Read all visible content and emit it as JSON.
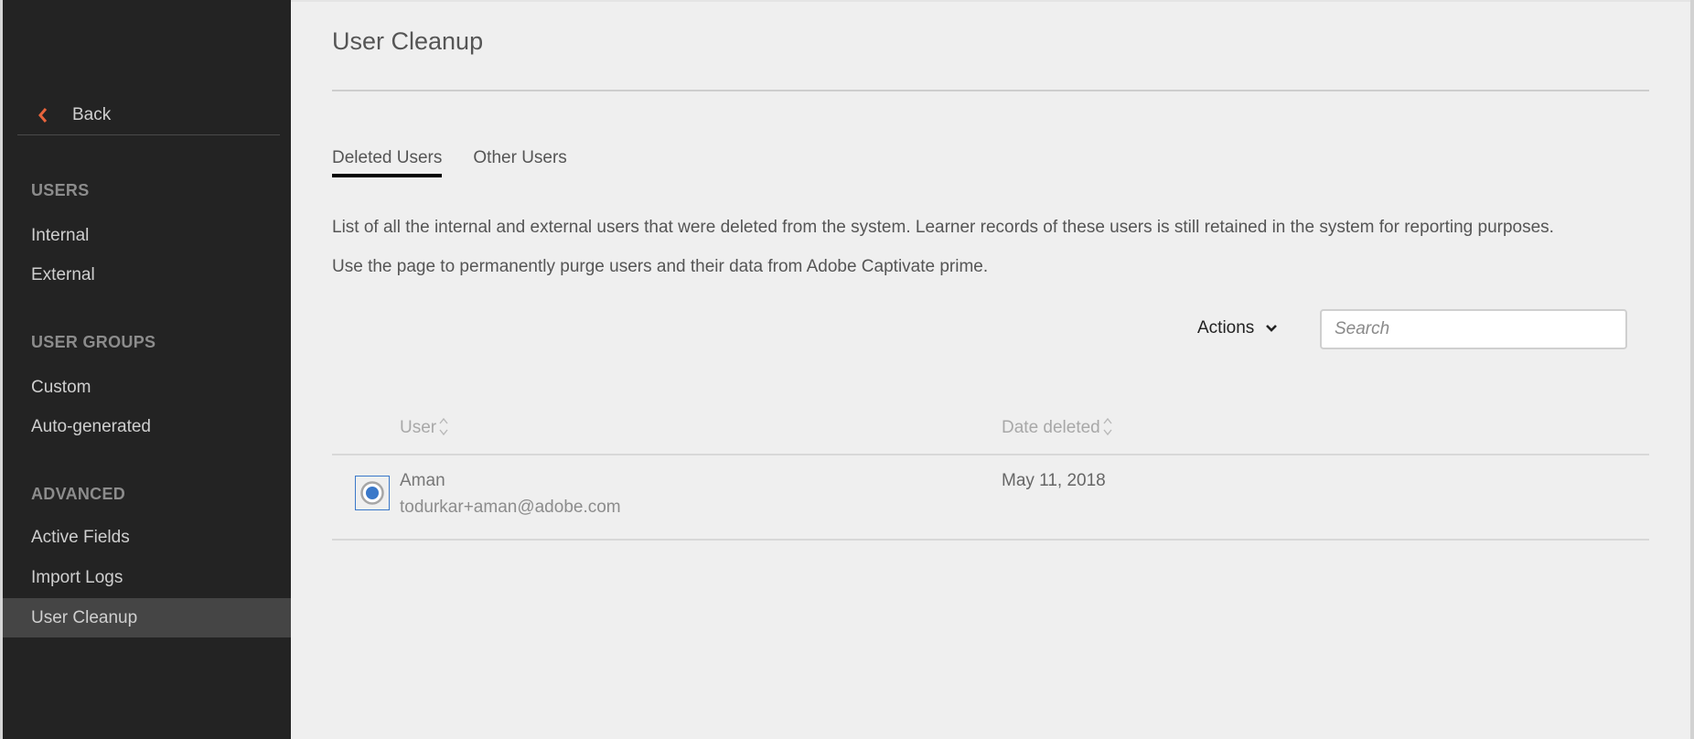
{
  "sidebar": {
    "back_label": "Back",
    "accent_color": "#e8643c",
    "sections": [
      {
        "title": "USERS",
        "items": [
          {
            "label": "Internal"
          },
          {
            "label": "External"
          }
        ]
      },
      {
        "title": "USER GROUPS",
        "items": [
          {
            "label": "Custom"
          },
          {
            "label": "Auto-generated"
          }
        ]
      },
      {
        "title": "ADVANCED",
        "items": [
          {
            "label": "Active Fields"
          },
          {
            "label": "Import Logs"
          },
          {
            "label": "User Cleanup",
            "active": true
          }
        ]
      }
    ]
  },
  "main": {
    "title": "User Cleanup",
    "tabs": [
      {
        "label": "Deleted Users",
        "active": true
      },
      {
        "label": "Other Users",
        "active": false
      }
    ],
    "description": [
      "List of all the internal and external users that were deleted from the system. Learner records of these users is still retained in the system for reporting purposes.",
      "Use the page to permanently purge users and their data from Adobe Captivate prime."
    ],
    "toolbar": {
      "actions_label": "Actions",
      "search_placeholder": "Search",
      "search_value": ""
    },
    "table": {
      "columns": [
        {
          "label": "User",
          "sortable": true
        },
        {
          "label": "Date deleted",
          "sortable": true
        }
      ],
      "rows": [
        {
          "name": "Aman",
          "email": "todurkar+aman@adobe.com",
          "date_deleted": "May 11, 2018",
          "selected": true
        }
      ]
    },
    "selection_color": "#3a78c9"
  }
}
